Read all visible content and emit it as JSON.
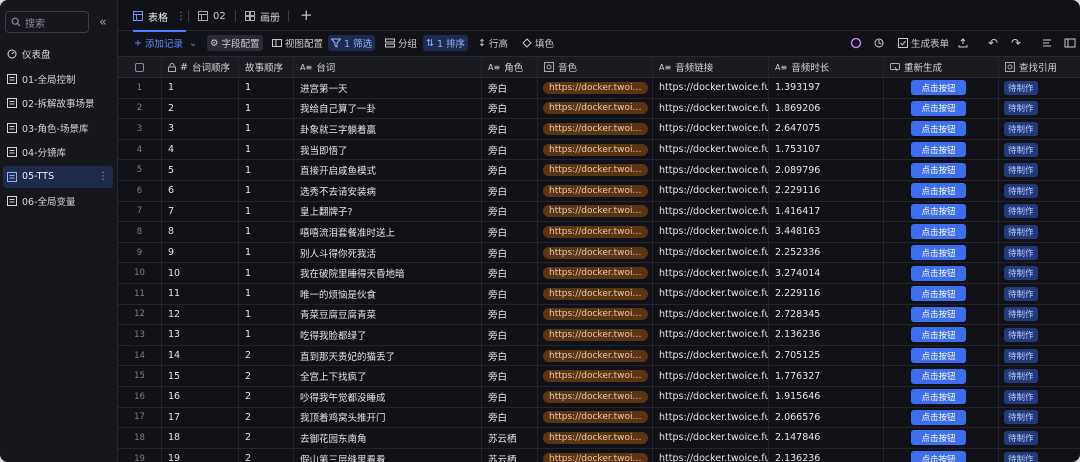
{
  "sidebar": {
    "search_placeholder": "搜索",
    "items": [
      {
        "label": "仪表盘",
        "icon": "dashboard-icon"
      },
      {
        "label": "01-全局控制",
        "icon": "table-icon"
      },
      {
        "label": "02-拆解故事场景",
        "icon": "table-icon"
      },
      {
        "label": "03-角色-场景库",
        "icon": "table-icon"
      },
      {
        "label": "04-分镜库",
        "icon": "table-icon"
      },
      {
        "label": "05-TTS",
        "icon": "table-icon",
        "active": true
      },
      {
        "label": "06-全局变量",
        "icon": "table-icon"
      }
    ]
  },
  "tabs": [
    {
      "label": "表格",
      "icon": "grid-icon",
      "active": true
    },
    {
      "label": "02",
      "icon": "grid-icon"
    },
    {
      "label": "画册",
      "icon": "gallery-icon"
    }
  ],
  "toolbar": {
    "add_record": "添加记录",
    "field_config": "字段配置",
    "view_config": "视图配置",
    "filter": "1 筛选",
    "group": "分组",
    "sort": "1 排序",
    "row_height": "行高",
    "fill_color": "填色",
    "generate_form": "生成表单"
  },
  "columns": {
    "order": "台词顺序",
    "story": "故事顺序",
    "line": "台词",
    "role": "角色",
    "voice": "音色",
    "link": "音频链接",
    "duration": "音频时长",
    "regen": "重新生成",
    "ref": "查找引用"
  },
  "cell_values": {
    "button_label": "点击按钮",
    "badge_label": "待制作",
    "voice_url": "https://docker.twoice.fun/...",
    "link_url": "https://docker.twoice.fu..."
  },
  "rows": [
    {
      "idx": "1",
      "order": "1",
      "story": "1",
      "line": "进宫第一天",
      "role": "旁白",
      "duration": "1.393197"
    },
    {
      "idx": "2",
      "order": "2",
      "story": "1",
      "line": "我给自己算了一卦",
      "role": "旁白",
      "duration": "1.869206"
    },
    {
      "idx": "3",
      "order": "3",
      "story": "1",
      "line": "卦象就三字躺着赢",
      "role": "旁白",
      "duration": "2.647075"
    },
    {
      "idx": "4",
      "order": "4",
      "story": "1",
      "line": "我当即悟了",
      "role": "旁白",
      "duration": "1.753107"
    },
    {
      "idx": "5",
      "order": "5",
      "story": "1",
      "line": "直接开启咸鱼模式",
      "role": "旁白",
      "duration": "2.089796"
    },
    {
      "idx": "6",
      "order": "6",
      "story": "1",
      "line": "选秀不去请安装病",
      "role": "旁白",
      "duration": "2.229116"
    },
    {
      "idx": "7",
      "order": "7",
      "story": "1",
      "line": "皇上翻牌子?",
      "role": "旁白",
      "duration": "1.416417"
    },
    {
      "idx": "8",
      "order": "8",
      "story": "1",
      "line": "嘻嘻流泪套餐准时送上",
      "role": "旁白",
      "duration": "3.448163"
    },
    {
      "idx": "9",
      "order": "9",
      "story": "1",
      "line": "别人斗得你死我活",
      "role": "旁白",
      "duration": "2.252336"
    },
    {
      "idx": "10",
      "order": "10",
      "story": "1",
      "line": "我在破院里睡得天昏地暗",
      "role": "旁白",
      "duration": "3.274014"
    },
    {
      "idx": "11",
      "order": "11",
      "story": "1",
      "line": "唯一的烦恼是伙食",
      "role": "旁白",
      "duration": "2.229116"
    },
    {
      "idx": "12",
      "order": "12",
      "story": "1",
      "line": "青菜豆腐豆腐青菜",
      "role": "旁白",
      "duration": "2.728345"
    },
    {
      "idx": "13",
      "order": "13",
      "story": "1",
      "line": "吃得我脸都绿了",
      "role": "旁白",
      "duration": "2.136236"
    },
    {
      "idx": "14",
      "order": "14",
      "story": "2",
      "line": "直到那天贵妃的猫丢了",
      "role": "旁白",
      "duration": "2.705125"
    },
    {
      "idx": "15",
      "order": "15",
      "story": "2",
      "line": "全宫上下找疯了",
      "role": "旁白",
      "duration": "1.776327"
    },
    {
      "idx": "16",
      "order": "16",
      "story": "2",
      "line": "吵得我午觉都没睡成",
      "role": "旁白",
      "duration": "1.915646"
    },
    {
      "idx": "17",
      "order": "17",
      "story": "2",
      "line": "我顶着鸡窝头推开门",
      "role": "旁白",
      "duration": "2.066576"
    },
    {
      "idx": "18",
      "order": "18",
      "story": "2",
      "line": "去御花园东南角",
      "role": "苏云栖",
      "duration": "2.147846"
    },
    {
      "idx": "19",
      "order": "19",
      "story": "2",
      "line": "假山第三层缝里看看",
      "role": "苏云栖",
      "duration": "2.136236"
    }
  ],
  "colors": {
    "accent": "#3d6ef0",
    "pill": "#5b3413",
    "badge": "#233a7a"
  }
}
